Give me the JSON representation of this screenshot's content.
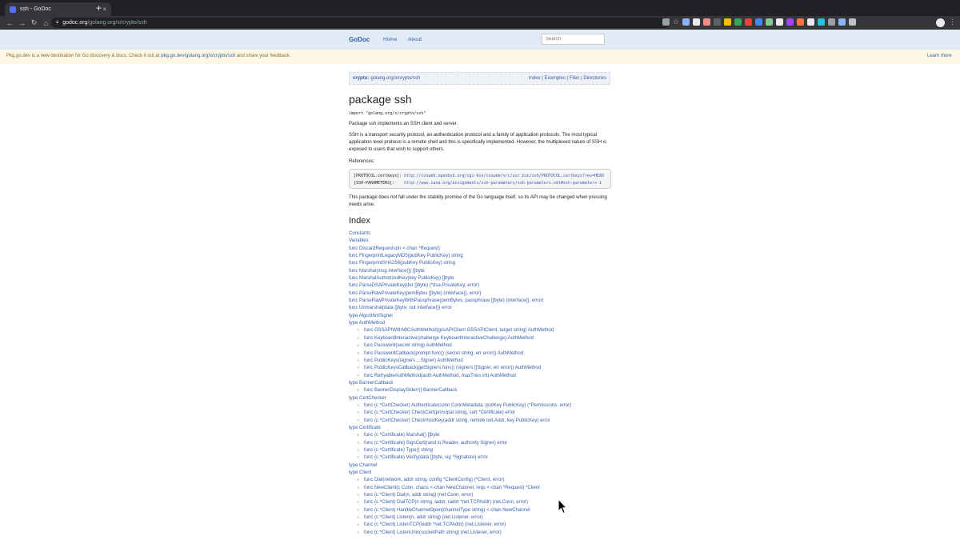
{
  "browser": {
    "tab_title": "ssh - GoDoc",
    "tab_close": "×",
    "new_tab": "+",
    "nav": {
      "back": "←",
      "forward": "→",
      "reload": "↻",
      "home": "⌂"
    },
    "url_host": "godoc.org",
    "url_path": "/golang.org/x/crypto/ssh",
    "bookmark_icon": "star-icon"
  },
  "site": {
    "brand": "GoDoc",
    "nav_home": "Home",
    "nav_about": "About",
    "search_placeholder": "Search"
  },
  "banner": {
    "text_before": "Pkg.go.dev is a new destination for Go discovery & docs. Check it out at ",
    "link": "pkg.go.dev/golang.org/x/crypto/ssh",
    "text_after": " and share your feedback.",
    "learn_more": "Learn more"
  },
  "breadcrumb": {
    "label": "crypto:",
    "path": "golang.org/x/crypto/ssh",
    "links": [
      "Index",
      "Examples",
      "Files",
      "Directories"
    ],
    "separator": "|"
  },
  "package": {
    "title": "package ssh",
    "import": "import \"golang.org/x/crypto/ssh\"",
    "summary": "Package ssh implements an SSH client and server.",
    "description": "SSH is a transport security protocol, an authentication protocol and a family of application protocols. The most typical application level protocol is a remote shell and this is specifically implemented. However, the multiplexed nature of SSH is exposed to users that wish to support others.",
    "references_label": "References:",
    "ref1_key": "[PROTOCOL.certkeys]: ",
    "ref1_url": "http://cvsweb.openbsd.org/cgi-bin/cvsweb/src/usr.bin/ssh/PROTOCOL.certkeys?rev=HEAD",
    "ref2_key": "[SSH-PARAMETERS]:    ",
    "ref2_url": "http://www.iana.org/assignments/ssh-parameters/ssh-parameters.xml#ssh-parameters-1",
    "stability": "This package does not fall under the stability promise of the Go language itself, so its API may be changed when pressing needs arise."
  },
  "index": {
    "title": "Index",
    "items": [
      {
        "text": "Constants",
        "sub": false
      },
      {
        "text": "Variables",
        "sub": false
      },
      {
        "text": "func DiscardRequests(in <-chan *Request)",
        "sub": false
      },
      {
        "text": "func FingerprintLegacyMD5(pubKey PublicKey) string",
        "sub": false
      },
      {
        "text": "func FingerprintSHA256(pubKey PublicKey) string",
        "sub": false
      },
      {
        "text": "func Marshal(msg interface{}) []byte",
        "sub": false
      },
      {
        "text": "func MarshalAuthorizedKey(key PublicKey) []byte",
        "sub": false
      },
      {
        "text": "func ParseDSAPrivateKey(der []byte) (*dsa.PrivateKey, error)",
        "sub": false
      },
      {
        "text": "func ParseRawPrivateKey(pemBytes []byte) (interface{}, error)",
        "sub": false
      },
      {
        "text": "func ParseRawPrivateKeyWithPassphrase(pemBytes, passphrase []byte) (interface{}, error)",
        "sub": false
      },
      {
        "text": "func Unmarshal(data []byte, out interface{}) error",
        "sub": false
      },
      {
        "text": "type AlgorithmSigner",
        "sub": false
      },
      {
        "text": "type AuthMethod",
        "sub": false
      },
      {
        "text": "func GSSAPIWithMICAuthMethod(gssAPIClient GSSAPIClient, target string) AuthMethod",
        "sub": true
      },
      {
        "text": "func KeyboardInteractive(challenge KeyboardInteractiveChallenge) AuthMethod",
        "sub": true
      },
      {
        "text": "func Password(secret string) AuthMethod",
        "sub": true
      },
      {
        "text": "func PasswordCallback(prompt func() (secret string, err error)) AuthMethod",
        "sub": true
      },
      {
        "text": "func PublicKeys(signers ...Signer) AuthMethod",
        "sub": true
      },
      {
        "text": "func PublicKeysCallback(getSigners func() (signers []Signer, err error)) AuthMethod",
        "sub": true
      },
      {
        "text": "func RetryableAuthMethod(auth AuthMethod, maxTries int) AuthMethod",
        "sub": true
      },
      {
        "text": "type BannerCallback",
        "sub": false
      },
      {
        "text": "func BannerDisplayStderr() BannerCallback",
        "sub": true
      },
      {
        "text": "type CertChecker",
        "sub": false
      },
      {
        "text": "func (c *CertChecker) Authenticate(conn ConnMetadata, pubKey PublicKey) (*Permissions, error)",
        "sub": true
      },
      {
        "text": "func (c *CertChecker) CheckCert(principal string, cert *Certificate) error",
        "sub": true
      },
      {
        "text": "func (c *CertChecker) CheckHostKey(addr string, remote net.Addr, key PublicKey) error",
        "sub": true
      },
      {
        "text": "type Certificate",
        "sub": false
      },
      {
        "text": "func (c *Certificate) Marshal() []byte",
        "sub": true
      },
      {
        "text": "func (c *Certificate) SignCert(rand io.Reader, authority Signer) error",
        "sub": true
      },
      {
        "text": "func (c *Certificate) Type() string",
        "sub": true
      },
      {
        "text": "func (c *Certificate) Verify(data []byte, sig *Signature) error",
        "sub": true
      },
      {
        "text": "type Channel",
        "sub": false
      },
      {
        "text": "type Client",
        "sub": false
      },
      {
        "text": "func Dial(network, addr string, config *ClientConfig) (*Client, error)",
        "sub": true
      },
      {
        "text": "func NewClient(c Conn, chans <-chan NewChannel, reqs <-chan *Request) *Client",
        "sub": true
      },
      {
        "text": "func (c *Client) Dial(n, addr string) (net.Conn, error)",
        "sub": true
      },
      {
        "text": "func (c *Client) DialTCP(n string, laddr, raddr *net.TCPAddr) (net.Conn, error)",
        "sub": true
      },
      {
        "text": "func (c *Client) HandleChannelOpen(channelType string) <-chan NewChannel",
        "sub": true
      },
      {
        "text": "func (c *Client) Listen(n, addr string) (net.Listener, error)",
        "sub": true
      },
      {
        "text": "func (c *Client) ListenTCP(laddr *net.TCPAddr) (net.Listener, error)",
        "sub": true
      },
      {
        "text": "func (c *Client) ListenUnix(socketPath string) (net.Listener, error)",
        "sub": true
      }
    ]
  },
  "colors": {
    "link": "#375eab",
    "header_bg": "#e0ebf5",
    "banner_bg": "#fcf8e3"
  }
}
